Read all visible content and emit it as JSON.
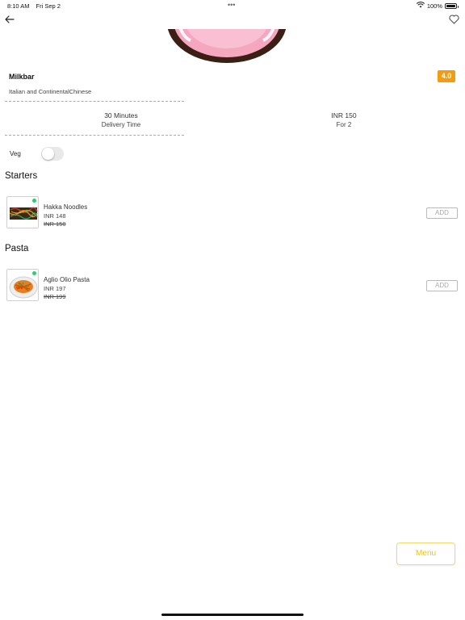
{
  "status_bar": {
    "time": "8:10 AM",
    "date": "Fri Sep 2",
    "dots": "•••",
    "battery": "100%",
    "battery_level": 1.0
  },
  "header": {
    "back_icon": "arrow-left-icon",
    "favorite_icon": "heart-outline-icon"
  },
  "restaurant": {
    "name": "Milkbar",
    "rating": "4.0",
    "cuisine": "Italian and ContinentalChinese",
    "delivery_time": "30 Minutes",
    "delivery_time_label": "Delivery Time",
    "cost": "INR 150",
    "cost_label": "For 2"
  },
  "filter": {
    "veg_label": "Veg",
    "veg_enabled": false
  },
  "sections": [
    {
      "title": "Starters",
      "items": [
        {
          "name": "Hakka Noodles",
          "price": "INR 148",
          "original_price": "INR 150",
          "add_label": "ADD"
        }
      ]
    },
    {
      "title": "Pasta",
      "items": [
        {
          "name": "Aglio Olio Pasta",
          "price": "INR 197",
          "original_price": "INR 199",
          "add_label": "ADD"
        }
      ]
    }
  ],
  "menu_button": "Menu",
  "colors": {
    "rating_bg": "#f39c12",
    "veg_dot": "#2ecc71",
    "menu_accent": "#f1c40f"
  }
}
